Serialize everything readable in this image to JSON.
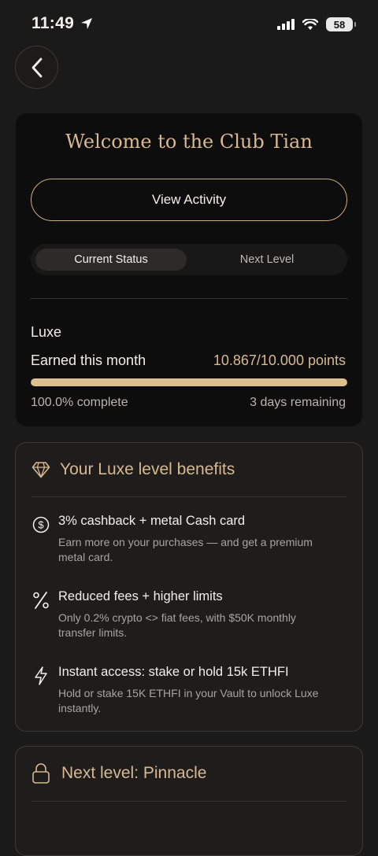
{
  "status_bar": {
    "time": "11:49",
    "battery": "58"
  },
  "colors": {
    "background": "#1b1a1a",
    "card_dark": "#0e0d0d",
    "card": "#1e1d1c",
    "gold": "#d7b891",
    "progress_fill": "#dcc08e"
  },
  "header": {
    "back_icon": "chevron-left-icon"
  },
  "club": {
    "welcome_title": "Welcome to the Club Tian",
    "view_activity_label": "View Activity",
    "tabs": [
      {
        "label": "Current Status",
        "active": true
      },
      {
        "label": "Next Level",
        "active": false
      }
    ],
    "level_name": "Luxe",
    "earned_label": "Earned this month",
    "earned_points": "10.867/10.000 points",
    "progress_fraction": 1.0,
    "percent_complete": "100.0% complete",
    "days_remaining": "3 days remaining"
  },
  "benefits": {
    "icon": "diamond-icon",
    "title": "Your Luxe level benefits",
    "items": [
      {
        "icon": "dollar-circle-icon",
        "title": "3% cashback + metal Cash card",
        "desc": "Earn more on your purchases — and get a premium metal card."
      },
      {
        "icon": "percent-icon",
        "title": "Reduced fees + higher limits",
        "desc": "Only 0.2% crypto <> fiat fees, with $50K monthly transfer limits."
      },
      {
        "icon": "lightning-icon",
        "title": "Instant access: stake or hold 15k ETHFI",
        "desc": "Hold or stake 15K ETHFI in your Vault to unlock Luxe instantly."
      }
    ]
  },
  "next_level": {
    "icon": "lock-icon",
    "title": "Next level: Pinnacle"
  }
}
